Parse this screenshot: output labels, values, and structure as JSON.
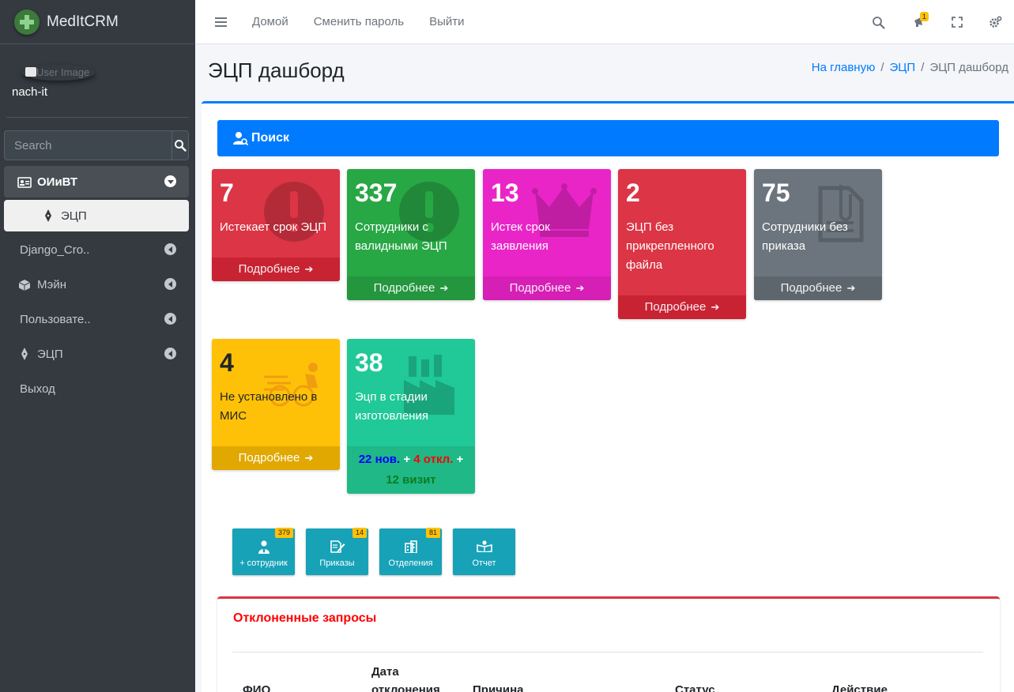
{
  "brand": {
    "name": "MedItCRM"
  },
  "user": {
    "image_alt": "User Image",
    "name": "nach-it"
  },
  "search": {
    "placeholder": "Search"
  },
  "sidebar": {
    "items": [
      {
        "label": "ОИиВТ",
        "icon": "id-card-icon",
        "state": "open"
      },
      {
        "label": "ЭЦП",
        "icon": "pen-nib-icon",
        "state": "active"
      },
      {
        "label": "Django_Cro..",
        "icon": "",
        "state": "collapsed"
      },
      {
        "label": "Мэйн",
        "icon": "cube-icon",
        "state": "collapsed"
      },
      {
        "label": "Пользовате..",
        "icon": "",
        "state": "collapsed"
      },
      {
        "label": "ЭЦП",
        "icon": "pen-nib-icon",
        "state": "collapsed"
      },
      {
        "label": "Выход",
        "icon": "",
        "state": "plain"
      }
    ]
  },
  "topbar": {
    "links": [
      "Домой",
      "Сменить пароль",
      "Выйти"
    ],
    "notification_count": "1"
  },
  "page": {
    "title": "ЭЦП дашборд",
    "breadcrumb": {
      "home": "На главную",
      "section": "ЭЦП",
      "current": "ЭЦП дашборд"
    }
  },
  "search_panel": {
    "label": "Поиск"
  },
  "boxes": [
    {
      "value": "7",
      "label": "Истекает срок ЭЦП",
      "footer": "Подробнее",
      "color": "#dc3545",
      "icon": "exclamation-icon"
    },
    {
      "value": "337",
      "label": "Сотрудники с валидными ЭЦП",
      "footer": "Подробнее",
      "color": "#28a745",
      "icon": "exclamation-icon"
    },
    {
      "value": "13",
      "label": "Истек срок заявления",
      "footer": "Подробнее",
      "color": "#ea25c8",
      "icon": "crown-icon"
    },
    {
      "value": "2",
      "label": "ЭЦП без прикрепленного файла",
      "footer": "Подробнее",
      "color": "#dc3545",
      "icon": ""
    },
    {
      "value": "75",
      "label": "Сотрудники без приказа",
      "footer": "Подробнее",
      "color": "#6c757d",
      "icon": "file-clip-icon"
    },
    {
      "value": "4",
      "label": "Не установлено в МИС",
      "footer": "Подробнее",
      "color": "#ffc107",
      "icon": "shipping-fast-icon"
    },
    {
      "value": "38",
      "label": "Эцп в стадии изготовления",
      "color": "#20c997",
      "icon": "industry-icon",
      "stats": {
        "new": "22 нов.",
        "rejected": "4 откл.",
        "visit": "12 визит",
        "plus": "+"
      }
    }
  ],
  "action_buttons": [
    {
      "label": "+ сотрудник",
      "count": "379",
      "icon": "user-tie-icon"
    },
    {
      "label": "Приказы",
      "count": "14",
      "icon": "file-signature-icon"
    },
    {
      "label": "Отделения",
      "count": "81",
      "icon": "building-icon"
    },
    {
      "label": "Отчет",
      "count": "",
      "icon": "book-reader-icon"
    }
  ],
  "rejected": {
    "title": "Отклоненные запросы",
    "columns": [
      "ФИО",
      "Дата отклонения",
      "Причина",
      "Статус",
      "Действие"
    ]
  }
}
